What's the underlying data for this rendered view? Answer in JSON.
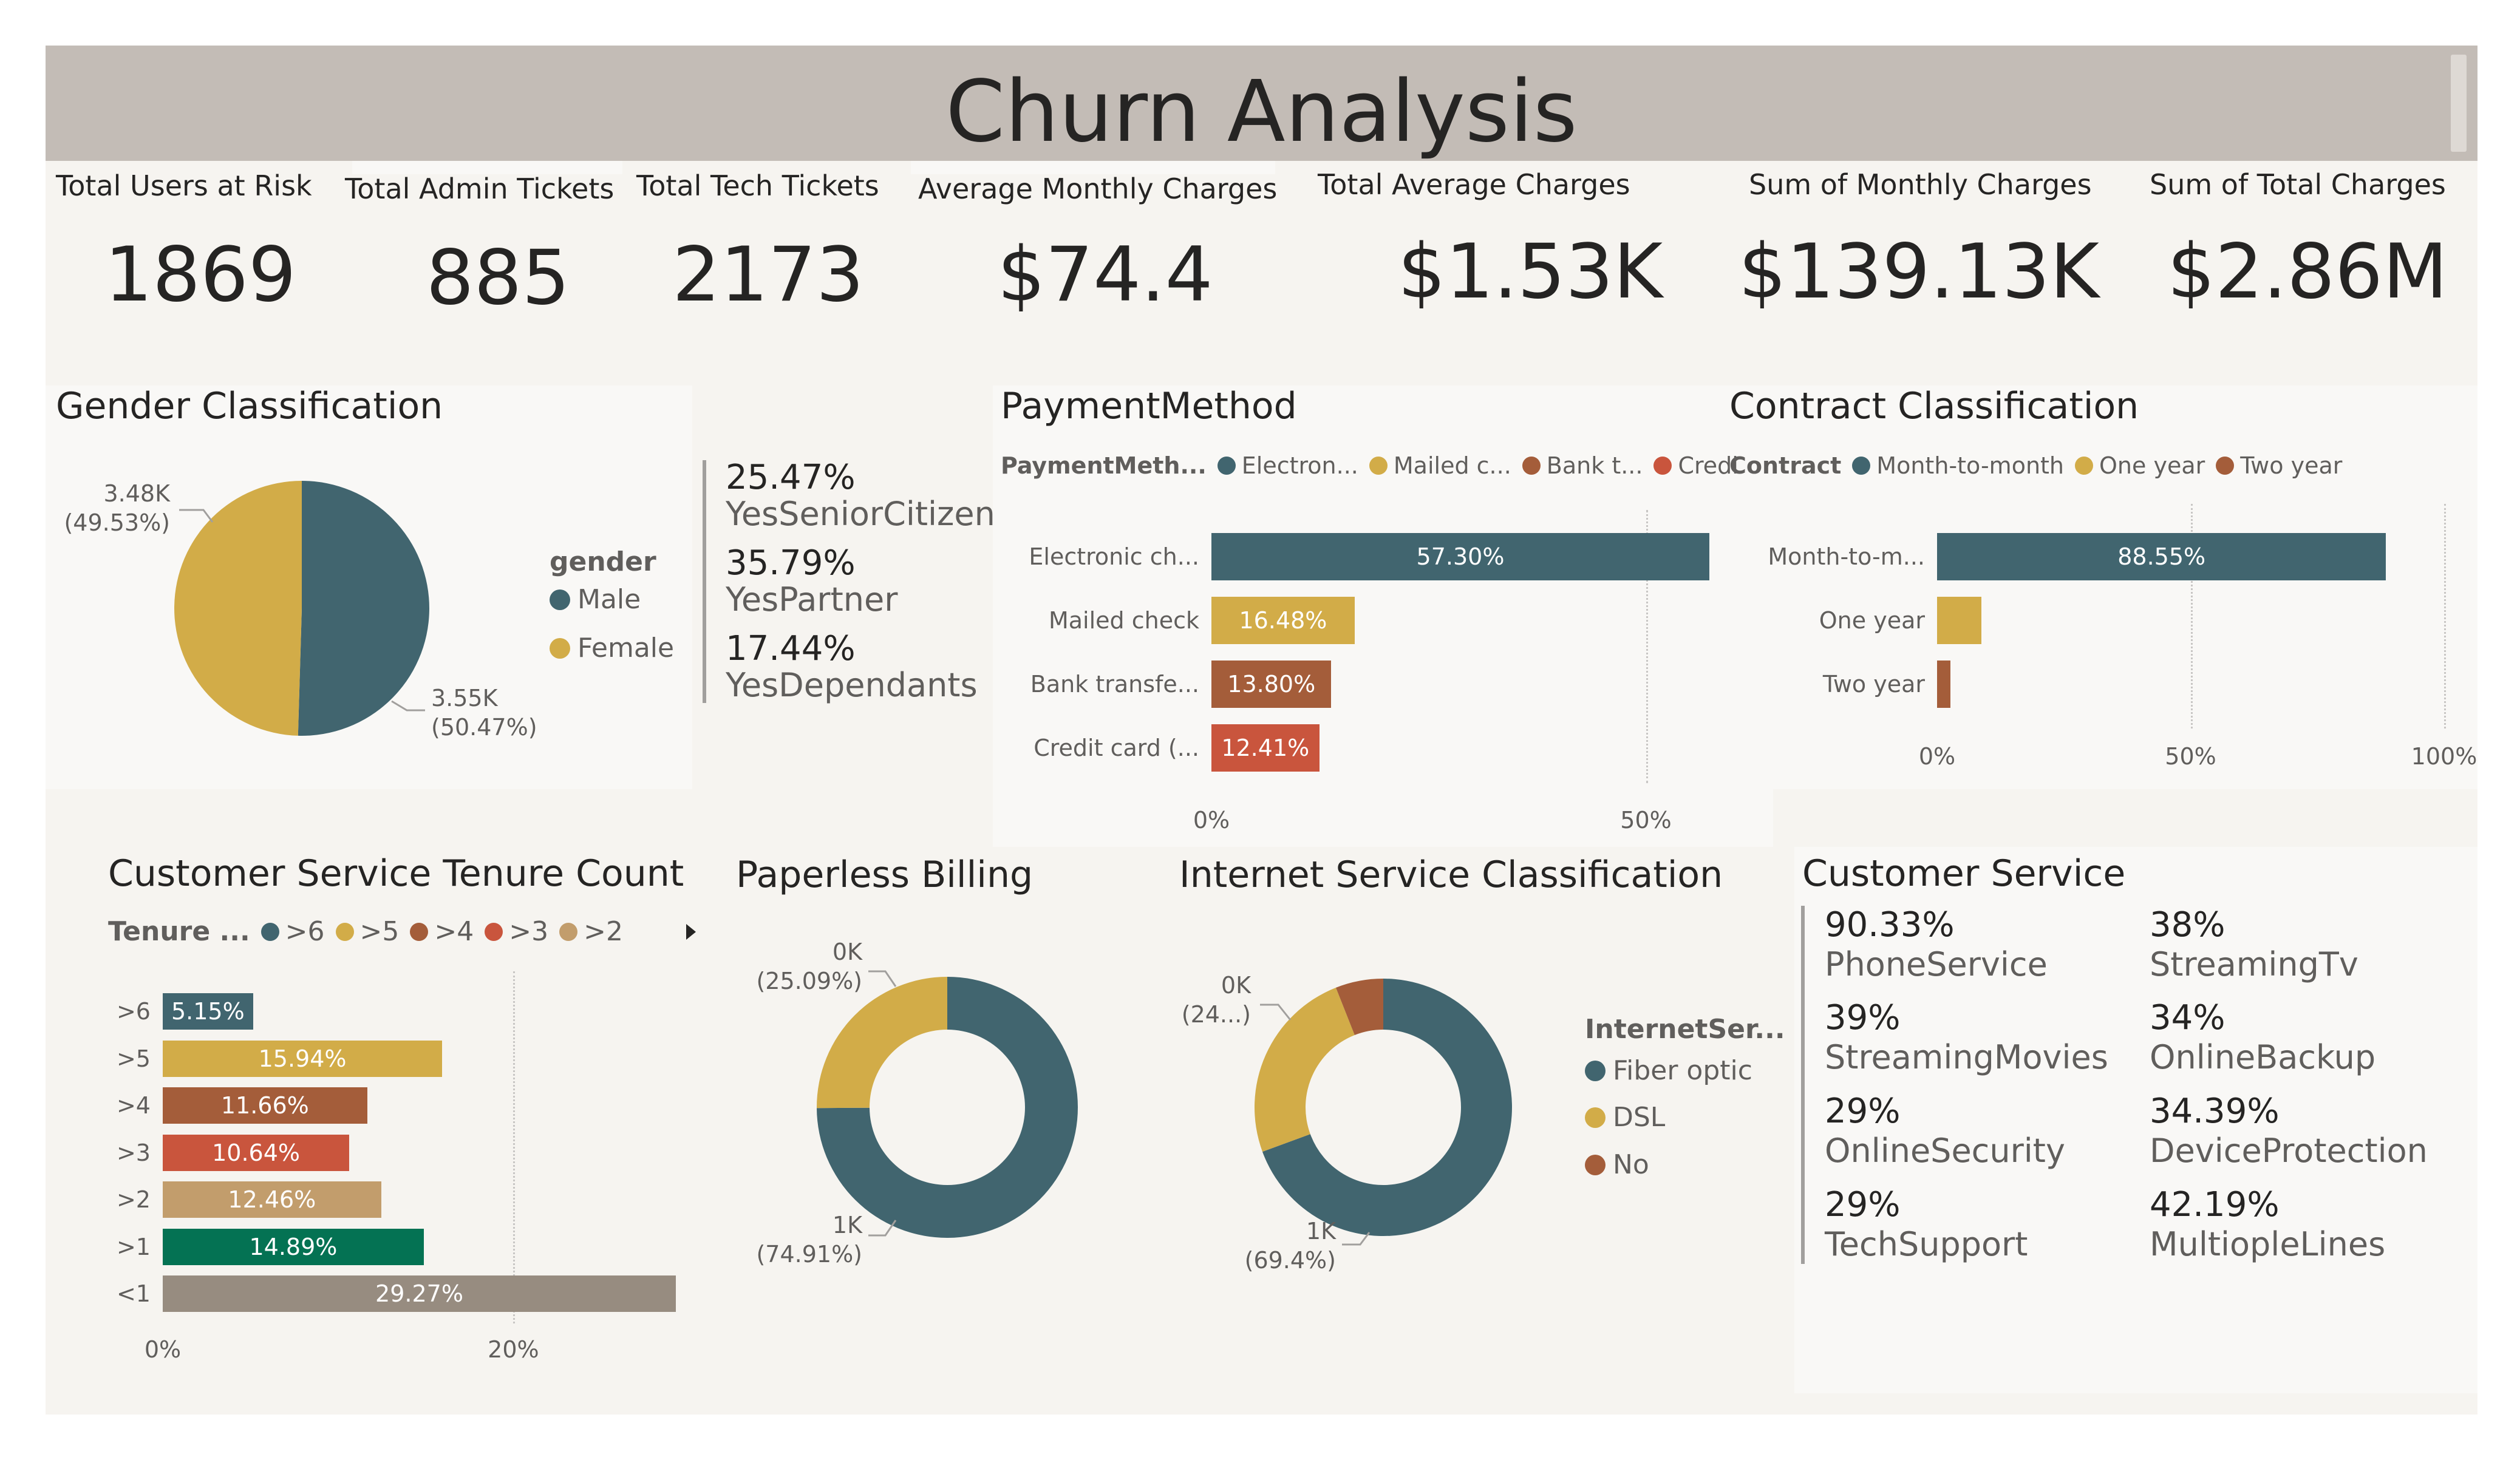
{
  "title": "Churn Analysis",
  "colors": {
    "teal": "#41656f",
    "gold": "#d2ac48",
    "brown": "#a45d3a",
    "red": "#c9553d",
    "tan": "#c29d6c",
    "green": "#047253",
    "gray": "#978c80"
  },
  "kpis": [
    {
      "label": "Total Users at Risk",
      "value": "1869"
    },
    {
      "label": "Total Admin Tickets",
      "value": "885"
    },
    {
      "label": "Total Tech Tickets",
      "value": "2173"
    },
    {
      "label": "Average Monthly Charges",
      "value": "$74.4"
    },
    {
      "label": "Total Average Charges",
      "value": "$1.53K"
    },
    {
      "label": "Sum of Monthly Charges",
      "value": "$139.13K"
    },
    {
      "label": "Sum of Total Charges",
      "value": "$2.86M"
    }
  ],
  "gender": {
    "title": "Gender Classification",
    "legend_title": "gender",
    "legend": [
      "Male",
      "Female"
    ],
    "label_male_1": "3.55K",
    "label_male_2": "(50.47%)",
    "label_female_1": "3.48K",
    "label_female_2": "(49.53%)"
  },
  "demographics": [
    {
      "value": "25.47%",
      "label": "YesSeniorCitizen"
    },
    {
      "value": "35.79%",
      "label": "YesPartner"
    },
    {
      "value": "17.44%",
      "label": "YesDependants"
    }
  ],
  "payment": {
    "title": "PaymentMethod",
    "legend_title": "PaymentMeth...",
    "legend": [
      "Electron...",
      "Mailed c...",
      "Bank t...",
      "Credi"
    ],
    "categories": [
      "Electronic ch...",
      "Mailed check",
      "Bank transfe...",
      "Credit card (..."
    ],
    "bar_labels": [
      "57.30%",
      "16.48%",
      "13.80%",
      "12.41%"
    ],
    "ticks": [
      "0%",
      "50%"
    ]
  },
  "contract": {
    "title": "Contract Classification",
    "legend_title": "Contract",
    "legend": [
      "Month-to-month",
      "One year",
      "Two year"
    ],
    "categories": [
      "Month-to-m...",
      "One year",
      "Two year"
    ],
    "bar_labels": [
      "88.55%"
    ],
    "ticks": [
      "0%",
      "50%",
      "100%"
    ]
  },
  "tenure": {
    "title": "Customer Service Tenure Count",
    "legend_title": "Tenure ...",
    "legend": [
      ">6",
      ">5",
      ">4",
      ">3",
      ">2"
    ],
    "categories": [
      ">6",
      ">5",
      ">4",
      ">3",
      ">2",
      ">1",
      "<1"
    ],
    "bar_labels": [
      "5.15%",
      "15.94%",
      "11.66%",
      "10.64%",
      "12.46%",
      "14.89%",
      "29.27%"
    ],
    "ticks": [
      "0%",
      "20%"
    ]
  },
  "paperless": {
    "title": "Paperless Billing",
    "label_a1": "0K",
    "label_a2": "(25.09%)",
    "label_b1": "1K",
    "label_b2": "(74.91%)"
  },
  "internet": {
    "title": "Internet Service Classification",
    "legend_title": "InternetSer...",
    "legend": [
      "Fiber optic",
      "DSL",
      "No"
    ],
    "label_a1": "0K",
    "label_a2": "(24...)",
    "label_b1": "1K",
    "label_b2": "(69.4%)"
  },
  "customer_service": {
    "title": "Customer Service",
    "items": [
      {
        "value": "90.33%",
        "label": "PhoneService"
      },
      {
        "value": "38%",
        "label": "StreamingTv"
      },
      {
        "value": "39%",
        "label": "StreamingMovies"
      },
      {
        "value": "34%",
        "label": "OnlineBackup"
      },
      {
        "value": "29%",
        "label": "OnlineSecurity"
      },
      {
        "value": "34.39%",
        "label": "DeviceProtection"
      },
      {
        "value": "29%",
        "label": "TechSupport"
      },
      {
        "value": "42.19%",
        "label": "MultiopleLines"
      }
    ]
  },
  "chart_data": [
    {
      "type": "pie",
      "title": "Gender Classification",
      "categories": [
        "Male",
        "Female"
      ],
      "values": [
        50.47,
        49.53
      ],
      "value_labels": [
        "3.55K",
        "3.48K"
      ],
      "legend_placement": "right"
    },
    {
      "type": "bar",
      "orientation": "horizontal",
      "title": "PaymentMethod",
      "categories": [
        "Electronic check",
        "Mailed check",
        "Bank transfer",
        "Credit card"
      ],
      "values": [
        57.3,
        16.48,
        13.8,
        12.41
      ],
      "xlim": [
        0,
        58
      ],
      "ticks": [
        0,
        50
      ],
      "grid": true,
      "legend_placement": "top"
    },
    {
      "type": "bar",
      "orientation": "horizontal",
      "title": "Contract Classification",
      "categories": [
        "Month-to-month",
        "One year",
        "Two year"
      ],
      "values": [
        88.55,
        8.8,
        2.65
      ],
      "xlim": [
        0,
        100
      ],
      "ticks": [
        0,
        50,
        100
      ],
      "grid": true,
      "legend_placement": "top"
    },
    {
      "type": "bar",
      "orientation": "horizontal",
      "title": "Customer Service Tenure Count",
      "categories": [
        ">6",
        ">5",
        ">4",
        ">3",
        ">2",
        ">1",
        "<1"
      ],
      "values": [
        5.15,
        15.94,
        11.66,
        10.64,
        12.46,
        14.89,
        29.27
      ],
      "xlim": [
        0,
        29.27
      ],
      "ticks": [
        0,
        20
      ],
      "grid": true,
      "legend_placement": "top"
    },
    {
      "type": "pie",
      "donut": true,
      "title": "Paperless Billing",
      "values": [
        74.91,
        25.09
      ],
      "value_labels": [
        "1K",
        "0K"
      ]
    },
    {
      "type": "pie",
      "donut": true,
      "title": "Internet Service Classification",
      "categories": [
        "Fiber optic",
        "DSL",
        "No"
      ],
      "values": [
        69.4,
        24.6,
        6.0
      ],
      "value_labels": [
        "1K",
        "0K"
      ],
      "legend_placement": "right"
    }
  ]
}
